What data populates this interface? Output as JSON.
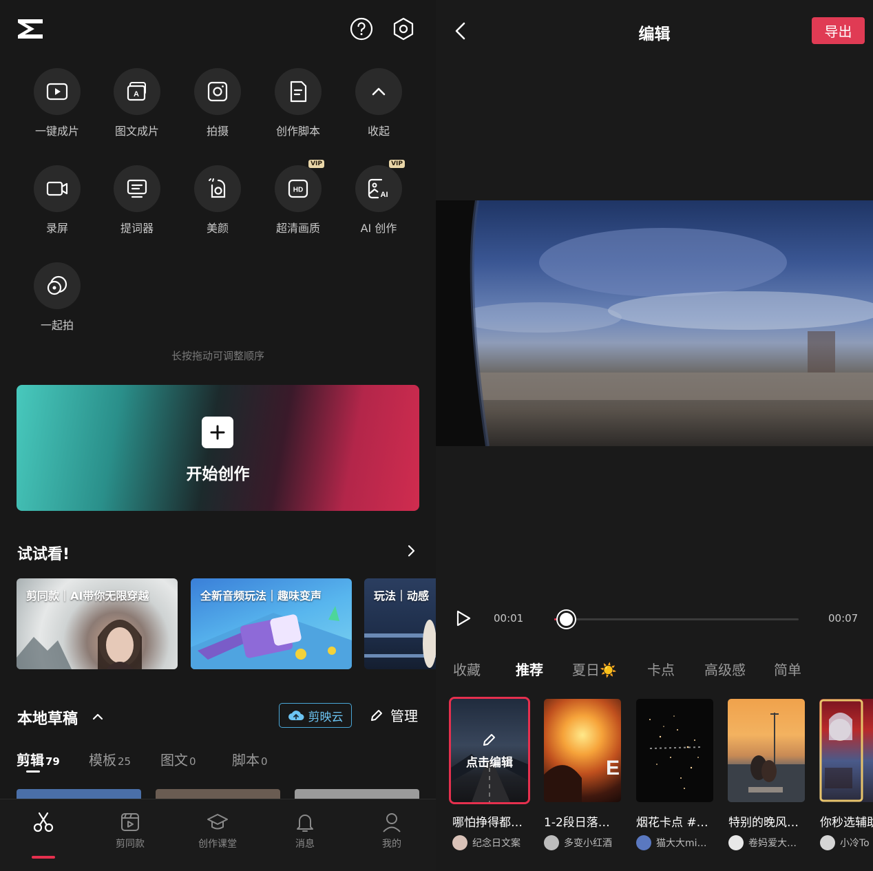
{
  "home": {
    "tools": [
      {
        "label": "一键成片",
        "icon": "play-square-icon"
      },
      {
        "label": "图文成片",
        "icon": "text-to-video-icon"
      },
      {
        "label": "拍摄",
        "icon": "camera-icon"
      },
      {
        "label": "创作脚本",
        "icon": "script-icon"
      },
      {
        "label": "收起",
        "icon": "chevron-up-icon"
      },
      {
        "label": "录屏",
        "icon": "video-camera-icon"
      },
      {
        "label": "提词器",
        "icon": "teleprompter-icon"
      },
      {
        "label": "美颜",
        "icon": "beauty-icon"
      },
      {
        "label": "超清画质",
        "icon": "hd-icon",
        "badge": "VIP"
      },
      {
        "label": "AI 创作",
        "icon": "ai-image-icon",
        "badge": "VIP"
      },
      {
        "label": "一起拍",
        "icon": "shoot-together-icon"
      }
    ],
    "hint": "长按拖动可调整顺序",
    "create_label": "开始创作",
    "try_section": {
      "title": "试试看!",
      "cards": [
        {
          "title": "剪同款｜AI带你无限穿越"
        },
        {
          "title": "全新音频玩法｜趣味变声"
        },
        {
          "title": "玩法｜动感"
        }
      ]
    },
    "drafts": {
      "title": "本地草稿",
      "cloud_label": "剪映云",
      "manage_label": "管理",
      "tabs": [
        {
          "label": "剪辑",
          "count": "79"
        },
        {
          "label": "模板",
          "count": "25"
        },
        {
          "label": "图文",
          "count": "0"
        },
        {
          "label": "脚本",
          "count": "0"
        }
      ]
    },
    "nav": [
      {
        "label": "",
        "icon": "scissors-icon"
      },
      {
        "label": "剪同款",
        "icon": "template-icon"
      },
      {
        "label": "创作课堂",
        "icon": "graduation-cap-icon"
      },
      {
        "label": "消息",
        "icon": "bell-icon"
      },
      {
        "label": "我的",
        "icon": "profile-icon"
      }
    ]
  },
  "editor": {
    "title": "编辑",
    "export_label": "导出",
    "time_current": "00:01",
    "time_total": "00:07",
    "progress": 0.05,
    "filter_tabs": [
      "收藏",
      "推荐",
      "夏日☀️",
      "卡点",
      "高级感",
      "简单"
    ],
    "edit_overlay": "点击编辑",
    "templates": [
      {
        "title": "哪怕挣得都…",
        "author": "纪念日文案"
      },
      {
        "title": "1-2段日落…",
        "author": "多变小红酒"
      },
      {
        "title": "烟花卡点 #…",
        "author": "猫大大mi…"
      },
      {
        "title": "特别的晚风…",
        "author": "卷妈爱大…"
      },
      {
        "title": "你秒选辅助",
        "author": "小冷To"
      }
    ]
  }
}
